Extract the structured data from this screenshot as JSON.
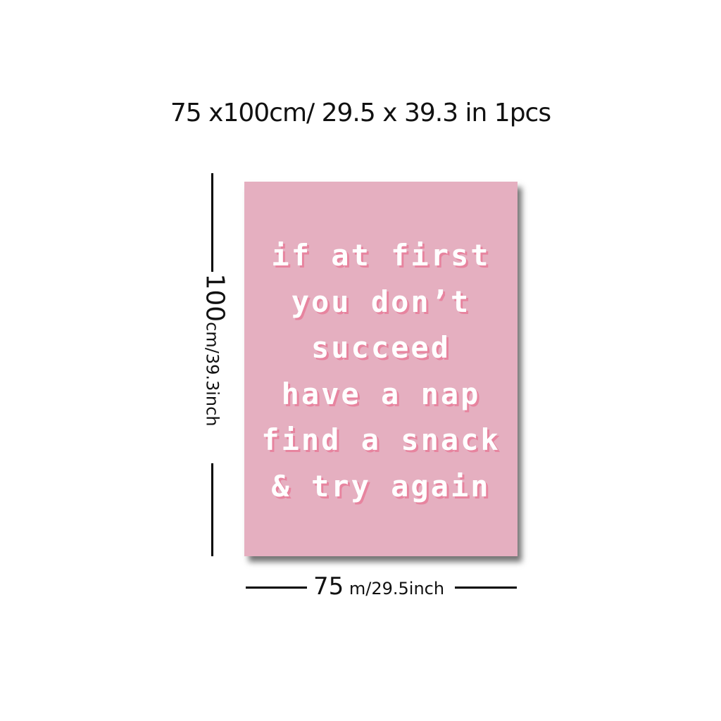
{
  "title": "75 x100cm/ 29.5 x 39.3 in 1pcs",
  "poster": {
    "background": "#e5afc0",
    "lines": [
      "if at first",
      "you don’t",
      "succeed",
      "have a nap",
      "find a snack",
      "& try again"
    ]
  },
  "height_label": {
    "number": "100",
    "unit": "cm/39.3inch"
  },
  "width_label": {
    "number": "75",
    "unit": " m/29.5inch"
  }
}
